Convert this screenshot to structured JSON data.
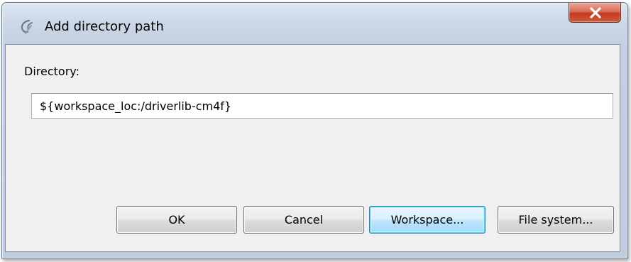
{
  "window": {
    "title": "Add directory path",
    "icon": "ccs-swirl-icon",
    "close_icon": "close-x-icon",
    "close_color": "#c4391f"
  },
  "form": {
    "directory_label": "Directory:",
    "directory_value": "${workspace_loc:/driverlib-cm4f}"
  },
  "buttons": {
    "ok": "OK",
    "cancel": "Cancel",
    "workspace": "Workspace...",
    "file_system": "File system..."
  }
}
